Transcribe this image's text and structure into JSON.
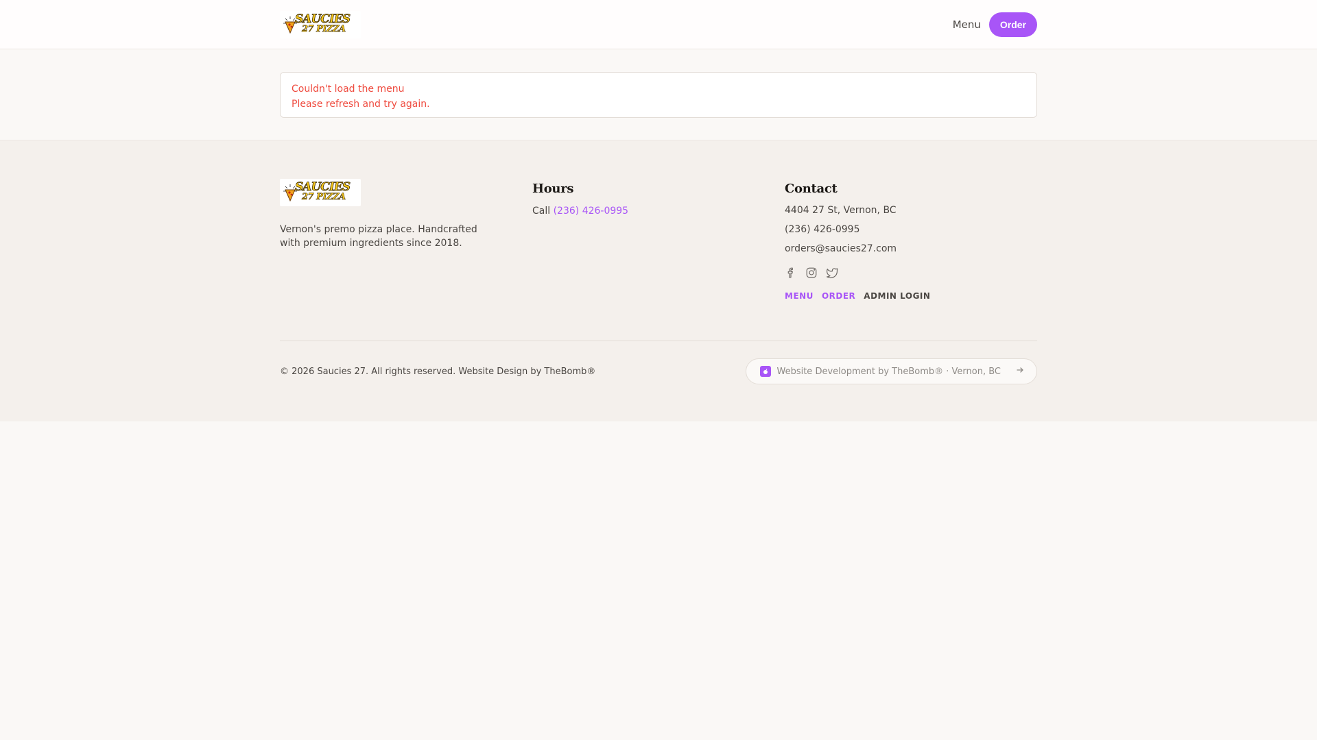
{
  "header": {
    "logo_alt": "Saucies 27 Pizza",
    "logo_word_top": "SAUCIES",
    "logo_word_bottom": "27 PIZZA",
    "nav_menu": "Menu",
    "nav_order": "Order"
  },
  "error": {
    "title": "Couldn't load the menu",
    "message": "Please refresh and try again."
  },
  "footer": {
    "tagline": "Vernon's premo pizza place. Handcrafted with premium ingredients since 2018.",
    "hours": {
      "heading": "Hours",
      "call_prefix": "Call",
      "phone": "(236) 426-0995"
    },
    "contact": {
      "heading": "Contact",
      "address": "4404 27 St, Vernon, BC",
      "phone": "(236) 426-0995",
      "email": "orders@saucies27.com"
    },
    "socials": [
      "facebook-icon",
      "instagram-icon",
      "twitter-icon"
    ],
    "links": {
      "menu": "MENU",
      "order": "ORDER",
      "admin": "ADMIN LOGIN"
    },
    "copyright": "© 2026 Saucies 27. All rights reserved. Website Design by TheBomb®",
    "credit": "Website Development by TheBomb® · Vernon, BC"
  },
  "colors": {
    "accent": "#a855f7",
    "error": "#ef4b3f",
    "footer_bg": "#f4f0ec"
  }
}
